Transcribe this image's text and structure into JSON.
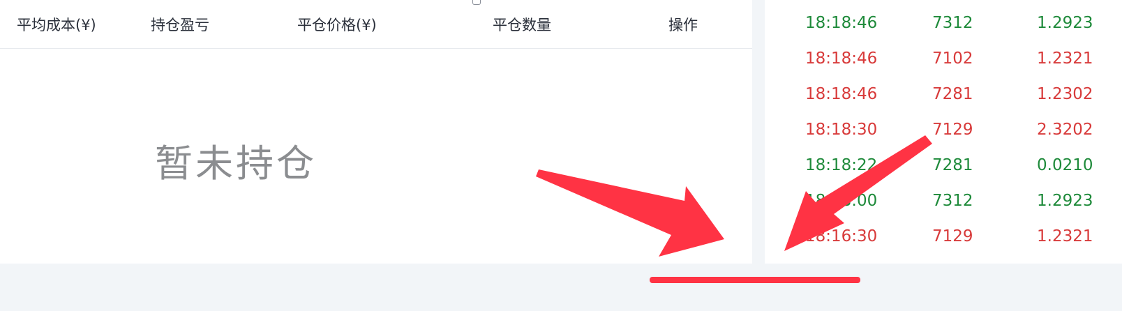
{
  "colors": {
    "up": "#1e8a3a",
    "down": "#d83a3a",
    "annotation": "#ff3344"
  },
  "positions_table": {
    "headers": [
      "平均成本(¥)",
      "持仓盈亏",
      "平仓价格(¥)",
      "平仓数量",
      "操作"
    ],
    "empty_message": "暂未持仓"
  },
  "trades": [
    {
      "time": "18:18:46",
      "qty": "7312",
      "price": "1.2923",
      "direction": "up"
    },
    {
      "time": "18:18:46",
      "qty": "7102",
      "price": "1.2321",
      "direction": "down"
    },
    {
      "time": "18:18:46",
      "qty": "7281",
      "price": "1.2302",
      "direction": "down"
    },
    {
      "time": "18:18:30",
      "qty": "7129",
      "price": "2.3202",
      "direction": "down"
    },
    {
      "time": "18:18:22",
      "qty": "7281",
      "price": "0.0210",
      "direction": "up"
    },
    {
      "time": "18:18:00",
      "qty": "7312",
      "price": "1.2923",
      "direction": "up"
    },
    {
      "time": "18:16:30",
      "qty": "7129",
      "price": "1.2321",
      "direction": "down"
    }
  ]
}
